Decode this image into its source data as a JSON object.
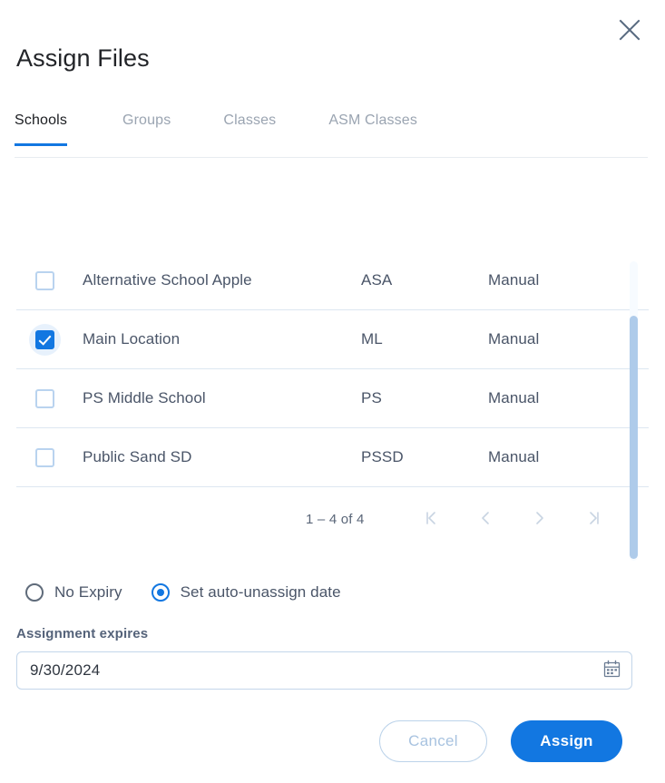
{
  "dialog": {
    "title": "Assign Files",
    "close_icon": "close-icon"
  },
  "tabs": [
    {
      "label": "Schools",
      "active": true
    },
    {
      "label": "Groups",
      "active": false
    },
    {
      "label": "Classes",
      "active": false
    },
    {
      "label": "ASM Classes",
      "active": false
    }
  ],
  "table": {
    "rows": [
      {
        "name": "Alternative School Apple",
        "abbr": "ASA",
        "type": "Manual",
        "checked": false
      },
      {
        "name": "Main Location",
        "abbr": "ML",
        "type": "Manual",
        "checked": true
      },
      {
        "name": "PS Middle School",
        "abbr": "PS",
        "type": "Manual",
        "checked": false
      },
      {
        "name": "Public Sand SD",
        "abbr": "PSSD",
        "type": "Manual",
        "checked": false
      }
    ]
  },
  "paginator": {
    "range_label": "1 – 4 of 4",
    "first_icon": "first-page-icon",
    "prev_icon": "previous-page-icon",
    "next_icon": "next-page-icon",
    "last_icon": "last-page-icon"
  },
  "expiry": {
    "options": [
      {
        "label": "No Expiry",
        "selected": false
      },
      {
        "label": "Set auto-unassign date",
        "selected": true
      }
    ],
    "field_label": "Assignment expires",
    "date_value": "9/30/2024",
    "date_placeholder": "m/d/yyyy",
    "calendar_icon": "calendar-icon"
  },
  "footer": {
    "cancel_label": "Cancel",
    "assign_label": "Assign"
  },
  "colors": {
    "accent": "#1277e1",
    "text": "#4a5568",
    "muted": "#9aa4b1",
    "divider": "#dde7f1",
    "scrollbar": "#aecbea"
  }
}
